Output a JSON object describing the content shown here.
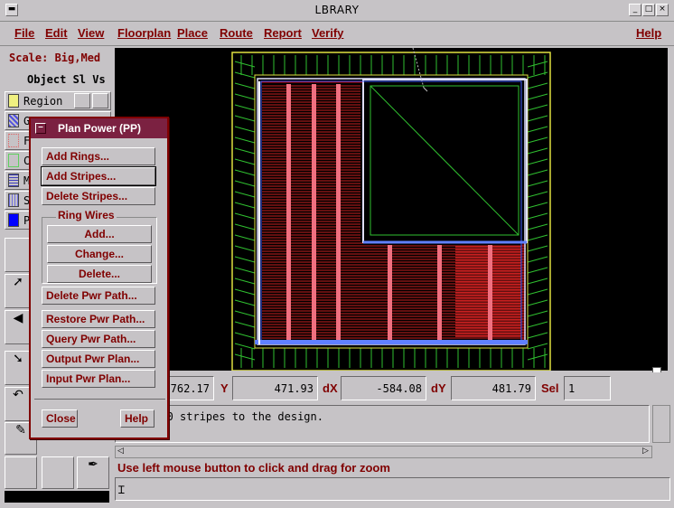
{
  "window": {
    "title": "LBRARY"
  },
  "menubar": [
    "File",
    "Edit",
    "View",
    "Floorplan",
    "Place",
    "Route",
    "Report",
    "Verify"
  ],
  "help_menu": "Help",
  "left_panel": {
    "scale_label": "Scale: Big,Med",
    "object_header": "Object Sl Vs",
    "layers": [
      {
        "label": "Region",
        "color": "#f0f080"
      },
      {
        "label": "G",
        "color": "#5050e0"
      },
      {
        "label": "F",
        "color": "#e06060"
      },
      {
        "label": "C",
        "color": "#60d060"
      },
      {
        "label": "M",
        "color": "#4040c0"
      },
      {
        "label": "S",
        "color": "#7070e0"
      },
      {
        "label": "P",
        "color": "#0000ff"
      }
    ]
  },
  "dialog": {
    "title": "Plan Power (PP)",
    "buttons": {
      "add_rings": "Add Rings...",
      "add_stripes": "Add Stripes...",
      "delete_stripes": "Delete Stripes...",
      "ring_group": "Ring Wires",
      "ring_add": "Add...",
      "ring_change": "Change...",
      "ring_delete": "Delete...",
      "delete_pwr_path": "Delete Pwr Path...",
      "restore_pwr_path": "Restore Pwr Path...",
      "query_pwr_path": "Query Pwr Path...",
      "output_pwr_plan": "Output Pwr Plan...",
      "input_pwr_plan": "Input Pwr Plan...",
      "close": "Close",
      "help": "Help"
    }
  },
  "coords": {
    "x_value": "-762.17",
    "y_label": "Y",
    "y_value": "471.93",
    "dx_label": "dX",
    "dx_value": "-584.08",
    "dy_label": "dY",
    "dy_value": "481.79",
    "sel_label": "Sel",
    "sel_value": "1"
  },
  "message": "Added 10 stripes to the design.",
  "status_hint": "Use left mouse button to click and drag for zoom",
  "colors": {
    "accent": "#800000",
    "dialog_title_bg": "#7b2141",
    "canvas_bg": "#000000"
  }
}
